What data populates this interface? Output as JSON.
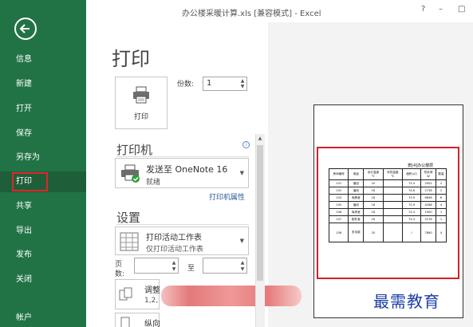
{
  "window": {
    "title": "办公楼采暖计算.xls  [兼容模式] - Excel",
    "help": "?",
    "minimize": "–",
    "maximize": "□"
  },
  "backstage": {
    "items": [
      {
        "label": "信息"
      },
      {
        "label": "新建"
      },
      {
        "label": "打开"
      },
      {
        "label": "保存"
      },
      {
        "label": "另存为"
      },
      {
        "label": "打印"
      },
      {
        "label": "共享"
      },
      {
        "label": "导出"
      },
      {
        "label": "发布"
      },
      {
        "label": "关闭"
      },
      {
        "label": "帐户"
      }
    ],
    "active_index": 5
  },
  "print": {
    "page_title": "打印",
    "button_label": "打印",
    "copies_label": "份数:",
    "copies_value": "1",
    "printer_header": "打印机",
    "printer_name": "发送至 OneNote 16",
    "printer_status": "就绪",
    "printer_props": "打印机属性",
    "settings_header": "设置",
    "scope_line1": "打印活动工作表",
    "scope_line2": "仅打印活动工作表",
    "pages_label": "页\n数:",
    "pages_to": "至",
    "scale_line1": "调整",
    "scale_line2": "1,2,",
    "orientation_line1": "纵向"
  },
  "preview": {
    "sheet_title": "表[4]办公楼层",
    "table": {
      "headers": [
        "房间编号",
        "用途",
        "设计温度\n℃",
        "传热温度\n℃",
        "面积(㎡)",
        "热负荷\nW",
        "数量"
      ],
      "rows": [
        [
          "101",
          "值班",
          "20",
          "",
          "75.4",
          "2902",
          "2"
        ],
        [
          "102",
          "值班",
          "18",
          "",
          "74.6",
          "2736",
          "2"
        ],
        [
          "103",
          "电教室",
          "18",
          "",
          "75.9",
          "6898",
          "6"
        ],
        [
          "105",
          "值班",
          "18",
          "",
          "75.9",
          "4288",
          "4"
        ],
        [
          "106",
          "库房室",
          "18",
          "",
          "74.3",
          "1900",
          "1"
        ],
        [
          "107",
          "配件室",
          "18",
          "",
          "74.3",
          "2276",
          "1"
        ],
        [
          "108",
          "多功能",
          "20",
          "",
          "/",
          "7880",
          "4"
        ]
      ]
    }
  },
  "watermark": "最需教育",
  "colors": {
    "backstage_green": "#217346",
    "active_green": "#1e5e39",
    "highlight_red": "#d32027",
    "link_blue": "#2b579a"
  }
}
